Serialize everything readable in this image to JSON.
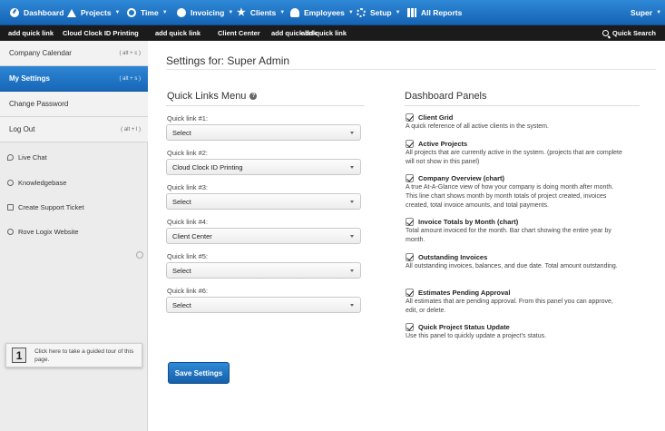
{
  "topnav": {
    "items": [
      {
        "label": "Dashboard",
        "icon": "dashboard-icon",
        "dropdown": false
      },
      {
        "label": "Projects",
        "icon": "projects-icon",
        "dropdown": true
      },
      {
        "label": "Time",
        "icon": "clock-icon",
        "dropdown": true
      },
      {
        "label": "Invoicing",
        "icon": "invoice-icon",
        "dropdown": true
      },
      {
        "label": "Clients",
        "icon": "star-icon",
        "dropdown": true
      },
      {
        "label": "Employees",
        "icon": "people-icon",
        "dropdown": true
      },
      {
        "label": "Setup",
        "icon": "gear-icon",
        "dropdown": true
      },
      {
        "label": "All Reports",
        "icon": "reports-icon",
        "dropdown": false
      }
    ],
    "user": "Super",
    "caret": "▼"
  },
  "quickbar": {
    "items": [
      "add quick link",
      "Cloud Clock ID Printing",
      "add quick link",
      "Client Center",
      "add quick link",
      "add quick link"
    ],
    "search_label": "Quick Search"
  },
  "sidebar": {
    "main": [
      {
        "label": "Company Calendar",
        "kbd": "( alt + c )",
        "active": false
      },
      {
        "label": "My Settings",
        "kbd": "( alt + s )",
        "active": true
      },
      {
        "label": "Change Password",
        "kbd": "",
        "active": false
      },
      {
        "label": "Log Out",
        "kbd": "( alt + l )",
        "active": false
      }
    ],
    "support": [
      {
        "label": "Live Chat",
        "icon": "chat-icon"
      },
      {
        "label": "Knowledgebase",
        "icon": "bulb-icon"
      },
      {
        "label": "Create Support Ticket",
        "icon": "ticket-icon"
      },
      {
        "label": "Rove Logix Website",
        "icon": "at-icon"
      }
    ],
    "tour": {
      "step": "1",
      "text": "Click here to take a guided tour of this page."
    }
  },
  "main": {
    "title": "Settings for: Super Admin",
    "quick_links": {
      "heading": "Quick Links Menu",
      "help": "?",
      "links": [
        {
          "label": "Quick link #1:",
          "value": "Select"
        },
        {
          "label": "Quick link #2:",
          "value": "Cloud Clock ID Printing"
        },
        {
          "label": "Quick link #3:",
          "value": "Select"
        },
        {
          "label": "Quick link #4:",
          "value": "Client Center"
        },
        {
          "label": "Quick link #5:",
          "value": "Select"
        },
        {
          "label": "Quick link #6:",
          "value": "Select"
        }
      ]
    },
    "dashboard_panels": {
      "heading": "Dashboard Panels",
      "panels": [
        {
          "name": "Client Grid",
          "checked": true,
          "desc": "A quick reference of all active clients in the system."
        },
        {
          "name": "Active Projects",
          "checked": true,
          "desc": "All projects that are currently active in the system. (projects that are complete will not show in this panel)"
        },
        {
          "name": "Company Overview (chart)",
          "checked": true,
          "desc": "A true At-A-Glance view of how your company is doing month after month. This line chart shows month by month totals of project created, invoices created, total invoice amounts, and total payments."
        },
        {
          "name": "Invoice Totals by Month (chart)",
          "checked": true,
          "desc": "Total amount invoiced for the month. Bar chart showing the entire year by month."
        },
        {
          "name": "Outstanding Invoices",
          "checked": true,
          "desc": "All outstanding invoices, balances, and due date. Total amount outstanding."
        },
        {
          "name": "Estimates Pending Approval",
          "checked": true,
          "desc": "All estimates that are pending approval. From this panel you can approve, edit, or delete."
        },
        {
          "name": "Quick Project Status Update",
          "checked": true,
          "desc": "Use this panel to quickly update a project's status."
        }
      ]
    },
    "save_label": "Save Settings"
  },
  "colors": {
    "nav_blue": "#1e72c4",
    "quickbar": "#1b1b1b",
    "sidebar_bg": "#ececec",
    "active_blue": "#1f76c6"
  }
}
